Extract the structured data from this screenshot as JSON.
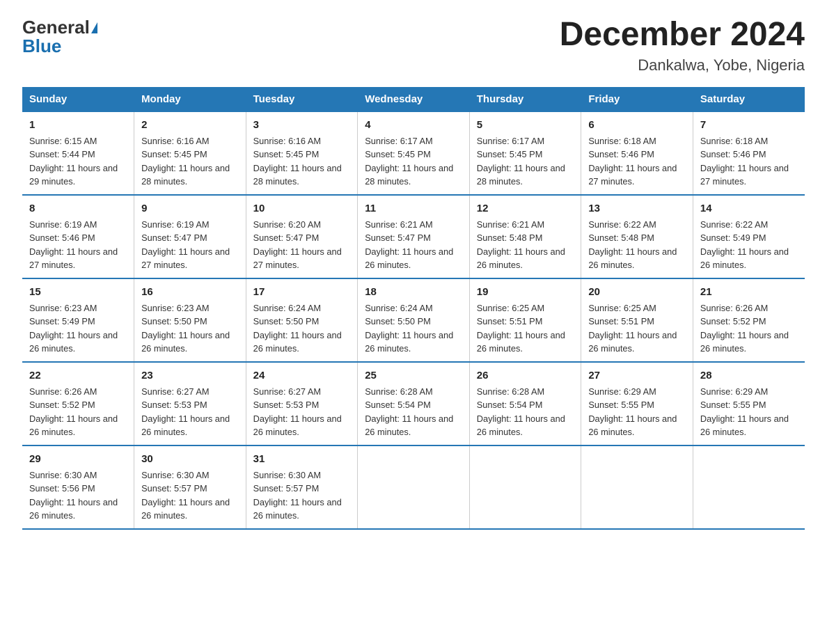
{
  "header": {
    "logo_general": "General",
    "logo_blue": "Blue",
    "title": "December 2024",
    "subtitle": "Dankalwa, Yobe, Nigeria"
  },
  "days_of_week": [
    "Sunday",
    "Monday",
    "Tuesday",
    "Wednesday",
    "Thursday",
    "Friday",
    "Saturday"
  ],
  "weeks": [
    [
      {
        "day": "1",
        "sunrise": "6:15 AM",
        "sunset": "5:44 PM",
        "daylight": "11 hours and 29 minutes."
      },
      {
        "day": "2",
        "sunrise": "6:16 AM",
        "sunset": "5:45 PM",
        "daylight": "11 hours and 28 minutes."
      },
      {
        "day": "3",
        "sunrise": "6:16 AM",
        "sunset": "5:45 PM",
        "daylight": "11 hours and 28 minutes."
      },
      {
        "day": "4",
        "sunrise": "6:17 AM",
        "sunset": "5:45 PM",
        "daylight": "11 hours and 28 minutes."
      },
      {
        "day": "5",
        "sunrise": "6:17 AM",
        "sunset": "5:45 PM",
        "daylight": "11 hours and 28 minutes."
      },
      {
        "day": "6",
        "sunrise": "6:18 AM",
        "sunset": "5:46 PM",
        "daylight": "11 hours and 27 minutes."
      },
      {
        "day": "7",
        "sunrise": "6:18 AM",
        "sunset": "5:46 PM",
        "daylight": "11 hours and 27 minutes."
      }
    ],
    [
      {
        "day": "8",
        "sunrise": "6:19 AM",
        "sunset": "5:46 PM",
        "daylight": "11 hours and 27 minutes."
      },
      {
        "day": "9",
        "sunrise": "6:19 AM",
        "sunset": "5:47 PM",
        "daylight": "11 hours and 27 minutes."
      },
      {
        "day": "10",
        "sunrise": "6:20 AM",
        "sunset": "5:47 PM",
        "daylight": "11 hours and 27 minutes."
      },
      {
        "day": "11",
        "sunrise": "6:21 AM",
        "sunset": "5:47 PM",
        "daylight": "11 hours and 26 minutes."
      },
      {
        "day": "12",
        "sunrise": "6:21 AM",
        "sunset": "5:48 PM",
        "daylight": "11 hours and 26 minutes."
      },
      {
        "day": "13",
        "sunrise": "6:22 AM",
        "sunset": "5:48 PM",
        "daylight": "11 hours and 26 minutes."
      },
      {
        "day": "14",
        "sunrise": "6:22 AM",
        "sunset": "5:49 PM",
        "daylight": "11 hours and 26 minutes."
      }
    ],
    [
      {
        "day": "15",
        "sunrise": "6:23 AM",
        "sunset": "5:49 PM",
        "daylight": "11 hours and 26 minutes."
      },
      {
        "day": "16",
        "sunrise": "6:23 AM",
        "sunset": "5:50 PM",
        "daylight": "11 hours and 26 minutes."
      },
      {
        "day": "17",
        "sunrise": "6:24 AM",
        "sunset": "5:50 PM",
        "daylight": "11 hours and 26 minutes."
      },
      {
        "day": "18",
        "sunrise": "6:24 AM",
        "sunset": "5:50 PM",
        "daylight": "11 hours and 26 minutes."
      },
      {
        "day": "19",
        "sunrise": "6:25 AM",
        "sunset": "5:51 PM",
        "daylight": "11 hours and 26 minutes."
      },
      {
        "day": "20",
        "sunrise": "6:25 AM",
        "sunset": "5:51 PM",
        "daylight": "11 hours and 26 minutes."
      },
      {
        "day": "21",
        "sunrise": "6:26 AM",
        "sunset": "5:52 PM",
        "daylight": "11 hours and 26 minutes."
      }
    ],
    [
      {
        "day": "22",
        "sunrise": "6:26 AM",
        "sunset": "5:52 PM",
        "daylight": "11 hours and 26 minutes."
      },
      {
        "day": "23",
        "sunrise": "6:27 AM",
        "sunset": "5:53 PM",
        "daylight": "11 hours and 26 minutes."
      },
      {
        "day": "24",
        "sunrise": "6:27 AM",
        "sunset": "5:53 PM",
        "daylight": "11 hours and 26 minutes."
      },
      {
        "day": "25",
        "sunrise": "6:28 AM",
        "sunset": "5:54 PM",
        "daylight": "11 hours and 26 minutes."
      },
      {
        "day": "26",
        "sunrise": "6:28 AM",
        "sunset": "5:54 PM",
        "daylight": "11 hours and 26 minutes."
      },
      {
        "day": "27",
        "sunrise": "6:29 AM",
        "sunset": "5:55 PM",
        "daylight": "11 hours and 26 minutes."
      },
      {
        "day": "28",
        "sunrise": "6:29 AM",
        "sunset": "5:55 PM",
        "daylight": "11 hours and 26 minutes."
      }
    ],
    [
      {
        "day": "29",
        "sunrise": "6:30 AM",
        "sunset": "5:56 PM",
        "daylight": "11 hours and 26 minutes."
      },
      {
        "day": "30",
        "sunrise": "6:30 AM",
        "sunset": "5:57 PM",
        "daylight": "11 hours and 26 minutes."
      },
      {
        "day": "31",
        "sunrise": "6:30 AM",
        "sunset": "5:57 PM",
        "daylight": "11 hours and 26 minutes."
      },
      null,
      null,
      null,
      null
    ]
  ]
}
